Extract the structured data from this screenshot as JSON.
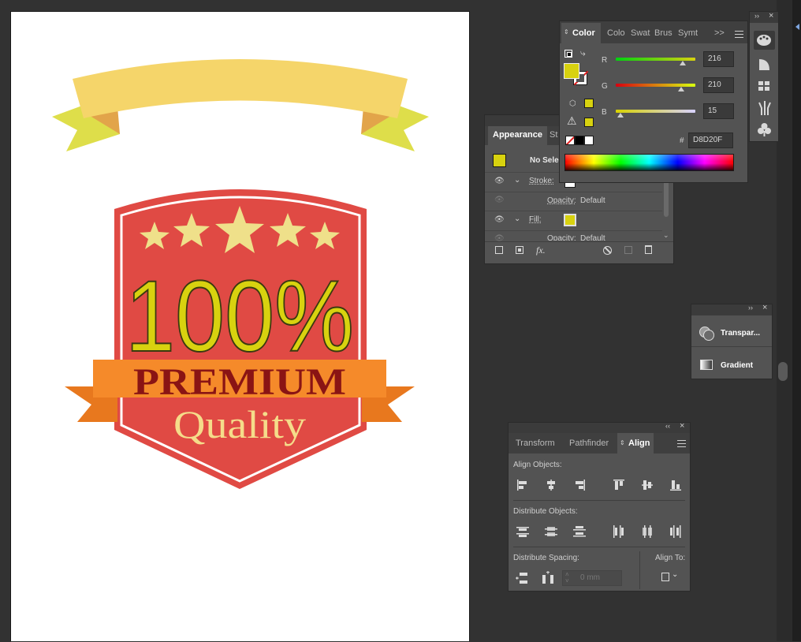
{
  "artwork": {
    "headline": "100%",
    "premium": "PREMIUM",
    "quality": "Quality",
    "colors": {
      "ribbon_top": "#f5d56a",
      "ribbon_tail": "#dede4a",
      "ribbon_fold": "#e2a44a",
      "shield": "#e04a44",
      "shield_border": "#ffffff",
      "stars": "#efe08a",
      "headline": "#d8d20f",
      "banner": "#f58a2a",
      "banner_tail": "#e8781e",
      "premium_text": "#8a1414",
      "quality_text": "#f5dc8a"
    }
  },
  "color_panel": {
    "tabs": [
      "Color",
      "Colo",
      "Swat",
      "Brus",
      "Symt"
    ],
    "overflow": ">>",
    "r_label": "R",
    "g_label": "G",
    "b_label": "B",
    "r_value": "216",
    "g_value": "210",
    "b_value": "15",
    "r": 216,
    "g": 210,
    "b": 15,
    "hash": "#",
    "hex": "D8D20F",
    "fill_color": "#d8d20f"
  },
  "appearance_panel": {
    "tabs": [
      "Appearance",
      "St"
    ],
    "title": "No Sele",
    "stroke_label": "Stroke:",
    "opacity_label": "Opacity:",
    "opacity_value": "Default",
    "fill_label": "Fill:",
    "opacity_label_2": "Opacity:",
    "opacity_value_2": "Default",
    "fx": "fx."
  },
  "transparency_panel": {
    "transparency_label": "Transpar...",
    "gradient_label": "Gradient"
  },
  "align_panel": {
    "tabs": [
      "Transform",
      "Pathfinder",
      "Align"
    ],
    "align_objects": "Align Objects:",
    "distribute_objects": "Distribute Objects:",
    "distribute_spacing": "Distribute Spacing:",
    "align_to": "Align To:",
    "spacing_value": "0 mm"
  }
}
